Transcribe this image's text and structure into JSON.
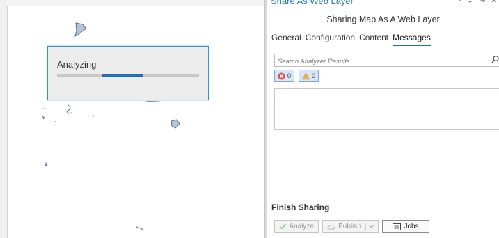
{
  "dialog": {
    "title": "Analyzing",
    "progress": {
      "start": 0.32,
      "end": 0.61
    }
  },
  "pane": {
    "title": "Share As Web Layer",
    "subtitle": "Sharing Map As A Web Layer",
    "tabs": [
      {
        "label": "General",
        "active": false
      },
      {
        "label": "Configuration",
        "active": false
      },
      {
        "label": "Content",
        "active": false
      },
      {
        "label": "Messages",
        "active": true
      }
    ],
    "search": {
      "placeholder": "Search Analyzer Results"
    },
    "counts": {
      "errors": "0",
      "warnings": "0"
    },
    "finish": {
      "title": "Finish Sharing",
      "analyze_label": "Analyze",
      "publish_label": "Publish",
      "jobs_label": "Jobs"
    }
  },
  "colors": {
    "accent": "#1f6fb6",
    "link": "#2677c6",
    "error": "#d9534f",
    "warning": "#f0ad4e",
    "analyze_check": "#4caf50"
  },
  "icons": [
    "search-icon",
    "error-icon",
    "warning-icon",
    "check-icon",
    "cloud-icon",
    "chevron-down-icon",
    "jobs-icon",
    "pane-controls-icon"
  ]
}
